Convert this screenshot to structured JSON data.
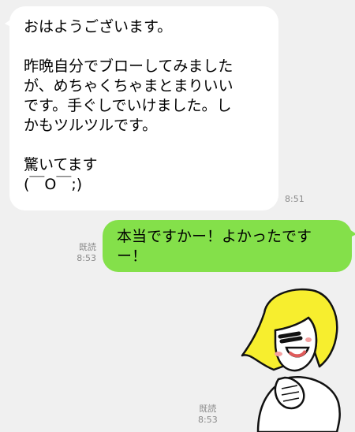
{
  "messages": [
    {
      "direction": "incoming",
      "lines": [
        "おはようございます。",
        "",
        "昨晩自分でブローしてみましたが、めちゃくちゃまとまりいい",
        "です。手ぐしでいけました。し",
        "かもツルツルです。",
        "",
        "驚いてます",
        "(￣O￣;)"
      ],
      "time": "8:51"
    },
    {
      "direction": "outgoing",
      "lines": [
        "本当ですかー！よかったです",
        "ー！"
      ],
      "read": "既読",
      "time": "8:53"
    },
    {
      "direction": "outgoing",
      "type": "sticker",
      "sticker": "blonde-woman-laughing-sticker",
      "read": "既読",
      "time": "8:53"
    }
  ],
  "colors": {
    "background": "#f0f0f0",
    "incoming_bubble": "#ffffff",
    "outgoing_bubble": "#84e04a",
    "meta_text": "#8a8a8a"
  }
}
